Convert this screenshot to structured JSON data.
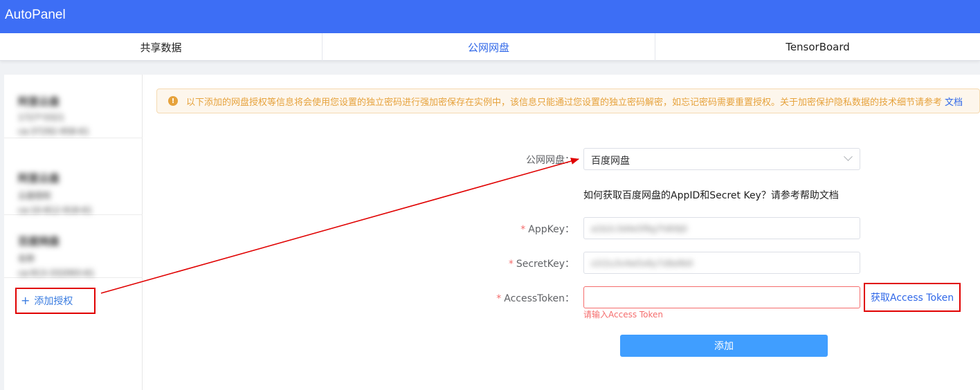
{
  "app": {
    "title": "AutoPanel"
  },
  "tabs": [
    {
      "label": "共享数据",
      "active": false
    },
    {
      "label": "公网网盘",
      "active": true
    },
    {
      "label": "TensorBoard",
      "active": false
    }
  ],
  "sidebar": {
    "cards": [
      {
        "line1": "阿里云盘",
        "line2": "1727*3321",
        "line3": "ca:37292-958-61"
      },
      {
        "line1": "阿里云盘",
        "line2": "云盘授权",
        "line3": "ca:10-812-918-61"
      },
      {
        "line1": "百度网盘",
        "line2": "名称",
        "line3": "ca:913-332093-61"
      }
    ],
    "add_label": "添加授权"
  },
  "notice": {
    "text": "以下添加的网盘授权等信息将会使用您设置的独立密码进行强加密保存在实例中，该信息只能通过您设置的独立密码解密，如忘记密码需要重置授权。关于加密保护隐私数据的技术细节请参考",
    "link": "文档"
  },
  "form": {
    "disk_label": "公网网盘：",
    "disk_value": "百度网盘",
    "help_text": "如何获取百度网盘的AppID和Secret Key？请参考帮助文档",
    "appkey_label": "AppKey：",
    "appkey_value": "a1b2c3d4e5f6g7h8i9j0",
    "secretkey_label": "SecretKey：",
    "secretkey_value": "s1t2u3v4w5x6y7z8a9b0",
    "token_label": "AccessToken：",
    "token_value": "",
    "token_error": "请输入Access Token",
    "token_link": "获取Access Token",
    "required_mark": "*",
    "submit_label": "添加"
  },
  "colors": {
    "primary": "#3d6ef5",
    "link": "#2f67e8",
    "warning": "#e6a23c",
    "error": "#f56c6c",
    "annotation": "#e00000"
  },
  "icons": {
    "notice": "warning-circle-icon",
    "add": "plus-icon",
    "dropdown": "chevron-down-icon"
  }
}
